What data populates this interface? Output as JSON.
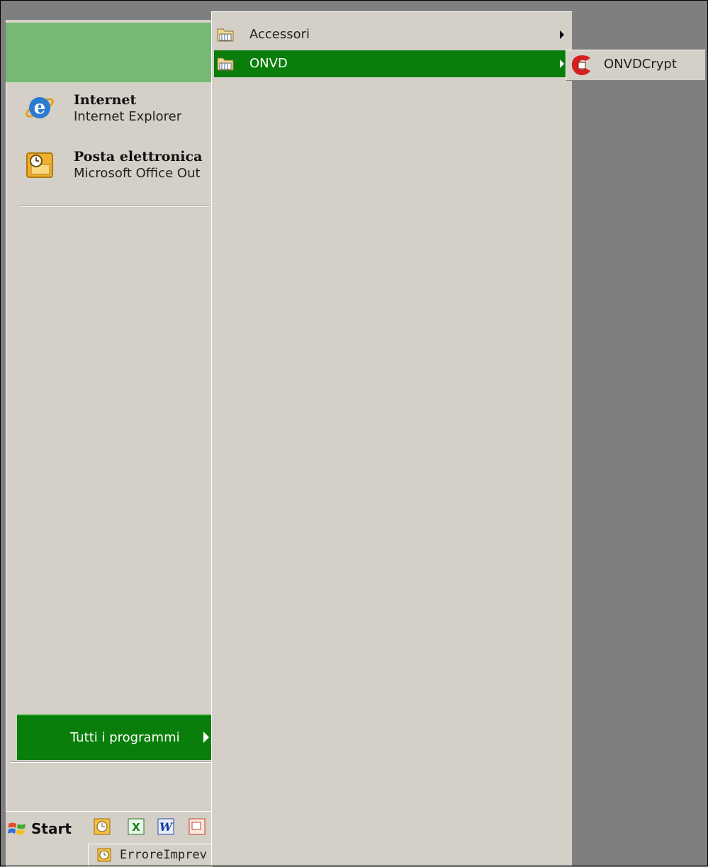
{
  "start_menu": {
    "pinned": [
      {
        "title": "Internet",
        "subtitle": "Internet Explorer",
        "icon": "internet-explorer-icon"
      },
      {
        "title": "Posta elettronica",
        "subtitle": "Microsoft Office Out",
        "icon": "outlook-icon"
      }
    ],
    "all_programs_label": "Tutti i programmi"
  },
  "programs_menu": {
    "items": [
      {
        "label": "Accessori",
        "icon": "folder-icon",
        "has_submenu": true,
        "selected": false
      },
      {
        "label": "ONVD",
        "icon": "folder-icon",
        "has_submenu": true,
        "selected": true
      }
    ]
  },
  "onvd_menu": {
    "items": [
      {
        "label": "ONVDCrypt",
        "icon": "onvdcrypt-icon"
      }
    ]
  },
  "taskbar": {
    "start_label": "Start",
    "quick_launch": [
      "outlook-icon",
      "excel-icon",
      "word-icon",
      "powerpoint-icon"
    ],
    "task_button_label": "ErroreImprev"
  },
  "colors": {
    "menu_bg": "#d4d0c8",
    "highlight_green": "#0a7e0a",
    "header_green": "#75b975",
    "desktop_gray": "#7f7f7f"
  }
}
